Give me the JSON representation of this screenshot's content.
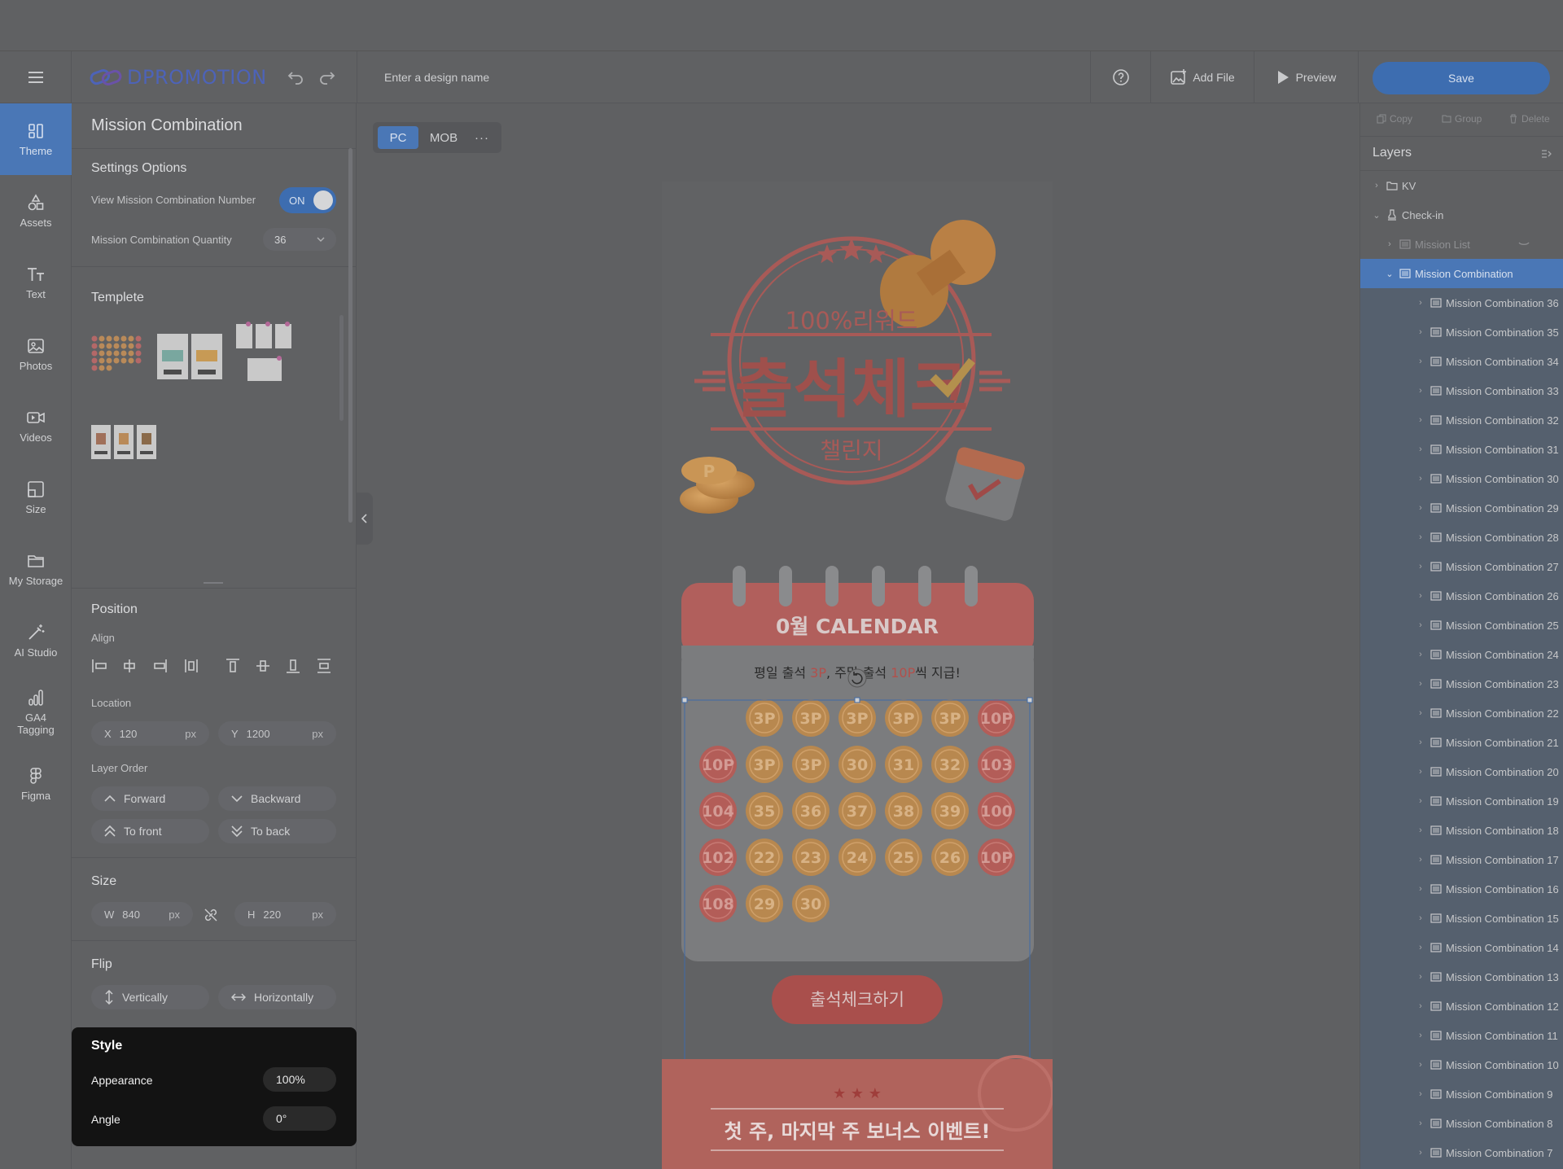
{
  "header": {
    "logo_text": "DPROMOTION",
    "design_name_placeholder": "Enter a design name",
    "add_file_label": "Add File",
    "preview_label": "Preview",
    "save_label": "Save"
  },
  "nav": {
    "items": [
      {
        "label": "Theme",
        "icon": "theme-icon",
        "active": true
      },
      {
        "label": "Assets",
        "icon": "assets-icon"
      },
      {
        "label": "Text",
        "icon": "text-icon"
      },
      {
        "label": "Photos",
        "icon": "photos-icon"
      },
      {
        "label": "Videos",
        "icon": "videos-icon"
      },
      {
        "label": "Size",
        "icon": "size-icon"
      },
      {
        "label": "My Storage",
        "icon": "folder-icon"
      },
      {
        "label": "AI Studio",
        "icon": "magic-wand-icon"
      },
      {
        "label": "GA4 Tagging",
        "icon": "bar-chart-icon"
      },
      {
        "label": "Figma",
        "icon": "figma-icon"
      }
    ]
  },
  "panel": {
    "title": "Mission Combination",
    "settings_heading": "Settings Options",
    "view_number_label": "View Mission Combination Number",
    "toggle_state": "ON",
    "quantity_label": "Mission Combination Quantity",
    "quantity_value": "36",
    "template_heading": "Templete",
    "position_heading": "Position",
    "align_label": "Align",
    "location_label": "Location",
    "x_label": "X",
    "x_value": "120",
    "y_label": "Y",
    "y_value": "1200",
    "unit": "px",
    "layer_order_label": "Layer Order",
    "forward_label": "Forward",
    "backward_label": "Backward",
    "to_front_label": "To front",
    "to_back_label": "To back",
    "size_heading": "Size",
    "w_label": "W",
    "w_value": "840",
    "h_label": "H",
    "h_value": "220",
    "flip_heading": "Flip",
    "vertically_label": "Vertically",
    "horizontally_label": "Horizontally"
  },
  "style": {
    "heading": "Style",
    "appearance_label": "Appearance",
    "appearance_value": "100%",
    "angle_label": "Angle",
    "angle_value": "0°"
  },
  "canvas": {
    "tabs": [
      "PC",
      "MOB"
    ],
    "more": "···",
    "promo": {
      "reward": "100%리워드",
      "headline": "출석체크",
      "challenge": "챌린지",
      "coin_letter": "P",
      "calendar_title": "0월 CALENDAR",
      "notice_parts": [
        "평일 출석 ",
        "3P",
        ", 주말 출석 ",
        "10P",
        "씩 지급!"
      ],
      "stamps": [
        "3P",
        "3P",
        "3P",
        "3P",
        "3P",
        "10P",
        "10P",
        "3P",
        "3P",
        "30",
        "31",
        "32",
        "103",
        "104",
        "35",
        "36",
        "37",
        "38",
        "39",
        "100",
        "102",
        "22",
        "23",
        "24",
        "25",
        "26",
        "10P",
        "108",
        "29",
        "30"
      ],
      "cta": "출석체크하기",
      "bonus": "첫 주, 마지막 주 보너스 이벤트!",
      "stars": "★ ★ ★"
    },
    "colors": {
      "accent": "#c86a66",
      "coin": "#c5914f",
      "panel_blue": "#4a77b6",
      "save_blue": "#3d6db0"
    }
  },
  "layers_panel": {
    "copy_label": "Copy",
    "group_label": "Group",
    "delete_label": "Delete",
    "title": "Layers",
    "top": [
      {
        "label": "KV",
        "depth": 0,
        "icon": "folder-icon"
      },
      {
        "label": "Check-in",
        "depth": 0,
        "icon": "stamp-icon",
        "expanded": true
      },
      {
        "label": "Mission List",
        "depth": 1,
        "dim": true
      },
      {
        "label": "Mission Combination",
        "depth": 1,
        "selected": true,
        "expanded": true
      }
    ],
    "children": [
      "Mission Combination 36",
      "Mission Combination 35",
      "Mission Combination 34",
      "Mission Combination 33",
      "Mission Combination 32",
      "Mission Combination 31",
      "Mission Combination 30",
      "Mission Combination 29",
      "Mission Combination 28",
      "Mission Combination 27",
      "Mission Combination 26",
      "Mission Combination 25",
      "Mission Combination 24",
      "Mission Combination 23",
      "Mission Combination 22",
      "Mission Combination 21",
      "Mission Combination 20",
      "Mission Combination 19",
      "Mission Combination 18",
      "Mission Combination 17",
      "Mission Combination 16",
      "Mission Combination 15",
      "Mission Combination 14",
      "Mission Combination 13",
      "Mission Combination 12",
      "Mission Combination 11",
      "Mission Combination 10",
      "Mission Combination 9",
      "Mission Combination 8",
      "Mission Combination 7"
    ]
  }
}
